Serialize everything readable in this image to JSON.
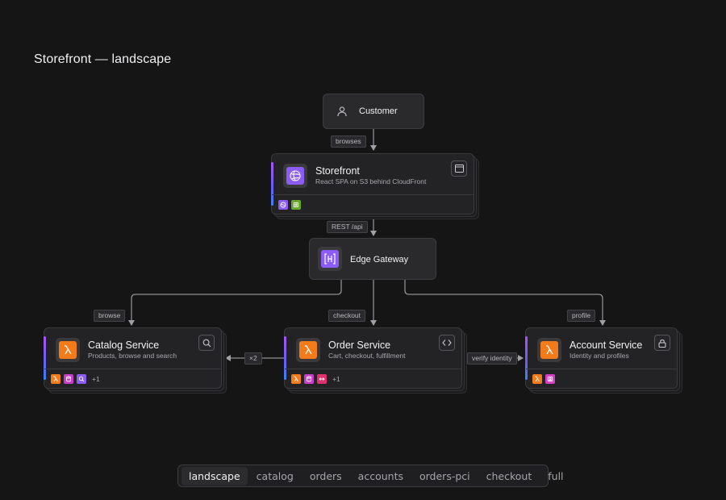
{
  "page": {
    "title": "Storefront — landscape"
  },
  "nodes": {
    "customer": {
      "title": "Customer",
      "icon": "user-icon"
    },
    "storefront": {
      "title": "Storefront",
      "subtitle": "React SPA on S3 behind CloudFront",
      "icon": "globe-icon",
      "action_icon": "browser-window-icon",
      "chips": [
        "cloudfront-icon",
        "s3-bucket-icon"
      ],
      "color": "#8b5cf6"
    },
    "gateway": {
      "title": "Edge Gateway",
      "icon": "api-gateway-icon",
      "color": "#8b5cf6"
    },
    "catalog": {
      "title": "Catalog Service",
      "subtitle": "Products, browse and search",
      "icon": "lambda-icon",
      "action_icon": "search-icon",
      "chips": [
        "lambda-icon",
        "dynamodb-icon",
        "opensearch-icon"
      ],
      "more": "+1",
      "color": "#f47b1a"
    },
    "order": {
      "title": "Order Service",
      "subtitle": "Cart, checkout, fulfillment",
      "icon": "lambda-icon",
      "action_icon": "code-icon",
      "chips": [
        "lambda-icon",
        "dynamodb-icon",
        "sqs-icon"
      ],
      "more": "+1",
      "color": "#f47b1a"
    },
    "account": {
      "title": "Account Service",
      "subtitle": "Identity and profiles",
      "icon": "lambda-icon",
      "action_icon": "lock-icon",
      "chips": [
        "lambda-icon",
        "cognito-icon"
      ],
      "color": "#f47b1a"
    }
  },
  "edges": {
    "browses": "browses",
    "rest_api": "REST /api",
    "browse": "browse",
    "checkout": "checkout",
    "profile": "profile",
    "x2": "×2",
    "verify_identity": "verify identity"
  },
  "colors": {
    "lambda": "#f47b1a",
    "dynamodb": "#c93ec9",
    "opensearch": "#8b5cf6",
    "sqs": "#e0306d",
    "cognito": "#d63fc4",
    "s3": "#6aa82b",
    "cloudfront": "#8b5cf6"
  },
  "tabs": [
    "landscape",
    "catalog",
    "orders",
    "accounts",
    "orders-pci",
    "checkout",
    "full"
  ],
  "active_tab": "landscape"
}
